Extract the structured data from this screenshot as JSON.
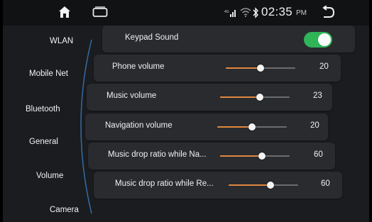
{
  "statusbar": {
    "time": "02:35",
    "ampm": "PM"
  },
  "sidebar": {
    "items": [
      {
        "label": "WLAN"
      },
      {
        "label": "Mobile Net"
      },
      {
        "label": "Bluetooth"
      },
      {
        "label": "General"
      },
      {
        "label": "Volume"
      },
      {
        "label": "Camera"
      }
    ]
  },
  "settings": {
    "keypad_sound": {
      "label": "Keypad Sound",
      "on": true
    },
    "rows": [
      {
        "label": "Phone volume",
        "value": "20",
        "level": 0.5
      },
      {
        "label": "Music volume",
        "value": "23",
        "level": 0.57
      },
      {
        "label": "Navigation volume",
        "value": "20",
        "level": 0.5
      },
      {
        "label": "Music drop ratio while Na...",
        "value": "60",
        "level": 0.6
      },
      {
        "label": "Music drop ratio while Re...",
        "value": "60",
        "level": 0.6
      }
    ]
  },
  "colors": {
    "accent": "#e0883f",
    "toggle_on": "#2fb457"
  }
}
